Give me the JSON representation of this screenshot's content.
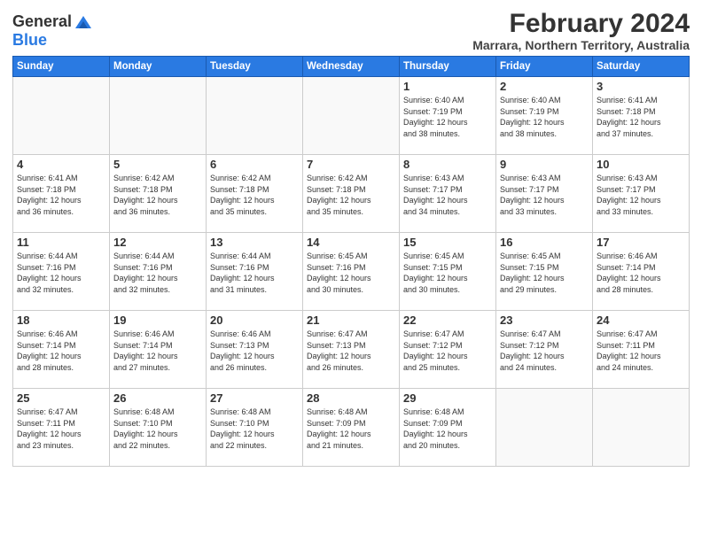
{
  "logo": {
    "general": "General",
    "blue": "Blue"
  },
  "title": "February 2024",
  "subtitle": "Marrara, Northern Territory, Australia",
  "days_of_week": [
    "Sunday",
    "Monday",
    "Tuesday",
    "Wednesday",
    "Thursday",
    "Friday",
    "Saturday"
  ],
  "weeks": [
    [
      {
        "day": "",
        "info": ""
      },
      {
        "day": "",
        "info": ""
      },
      {
        "day": "",
        "info": ""
      },
      {
        "day": "",
        "info": ""
      },
      {
        "day": "1",
        "info": "Sunrise: 6:40 AM\nSunset: 7:19 PM\nDaylight: 12 hours\nand 38 minutes."
      },
      {
        "day": "2",
        "info": "Sunrise: 6:40 AM\nSunset: 7:19 PM\nDaylight: 12 hours\nand 38 minutes."
      },
      {
        "day": "3",
        "info": "Sunrise: 6:41 AM\nSunset: 7:18 PM\nDaylight: 12 hours\nand 37 minutes."
      }
    ],
    [
      {
        "day": "4",
        "info": "Sunrise: 6:41 AM\nSunset: 7:18 PM\nDaylight: 12 hours\nand 36 minutes."
      },
      {
        "day": "5",
        "info": "Sunrise: 6:42 AM\nSunset: 7:18 PM\nDaylight: 12 hours\nand 36 minutes."
      },
      {
        "day": "6",
        "info": "Sunrise: 6:42 AM\nSunset: 7:18 PM\nDaylight: 12 hours\nand 35 minutes."
      },
      {
        "day": "7",
        "info": "Sunrise: 6:42 AM\nSunset: 7:18 PM\nDaylight: 12 hours\nand 35 minutes."
      },
      {
        "day": "8",
        "info": "Sunrise: 6:43 AM\nSunset: 7:17 PM\nDaylight: 12 hours\nand 34 minutes."
      },
      {
        "day": "9",
        "info": "Sunrise: 6:43 AM\nSunset: 7:17 PM\nDaylight: 12 hours\nand 33 minutes."
      },
      {
        "day": "10",
        "info": "Sunrise: 6:43 AM\nSunset: 7:17 PM\nDaylight: 12 hours\nand 33 minutes."
      }
    ],
    [
      {
        "day": "11",
        "info": "Sunrise: 6:44 AM\nSunset: 7:16 PM\nDaylight: 12 hours\nand 32 minutes."
      },
      {
        "day": "12",
        "info": "Sunrise: 6:44 AM\nSunset: 7:16 PM\nDaylight: 12 hours\nand 32 minutes."
      },
      {
        "day": "13",
        "info": "Sunrise: 6:44 AM\nSunset: 7:16 PM\nDaylight: 12 hours\nand 31 minutes."
      },
      {
        "day": "14",
        "info": "Sunrise: 6:45 AM\nSunset: 7:16 PM\nDaylight: 12 hours\nand 30 minutes."
      },
      {
        "day": "15",
        "info": "Sunrise: 6:45 AM\nSunset: 7:15 PM\nDaylight: 12 hours\nand 30 minutes."
      },
      {
        "day": "16",
        "info": "Sunrise: 6:45 AM\nSunset: 7:15 PM\nDaylight: 12 hours\nand 29 minutes."
      },
      {
        "day": "17",
        "info": "Sunrise: 6:46 AM\nSunset: 7:14 PM\nDaylight: 12 hours\nand 28 minutes."
      }
    ],
    [
      {
        "day": "18",
        "info": "Sunrise: 6:46 AM\nSunset: 7:14 PM\nDaylight: 12 hours\nand 28 minutes."
      },
      {
        "day": "19",
        "info": "Sunrise: 6:46 AM\nSunset: 7:14 PM\nDaylight: 12 hours\nand 27 minutes."
      },
      {
        "day": "20",
        "info": "Sunrise: 6:46 AM\nSunset: 7:13 PM\nDaylight: 12 hours\nand 26 minutes."
      },
      {
        "day": "21",
        "info": "Sunrise: 6:47 AM\nSunset: 7:13 PM\nDaylight: 12 hours\nand 26 minutes."
      },
      {
        "day": "22",
        "info": "Sunrise: 6:47 AM\nSunset: 7:12 PM\nDaylight: 12 hours\nand 25 minutes."
      },
      {
        "day": "23",
        "info": "Sunrise: 6:47 AM\nSunset: 7:12 PM\nDaylight: 12 hours\nand 24 minutes."
      },
      {
        "day": "24",
        "info": "Sunrise: 6:47 AM\nSunset: 7:11 PM\nDaylight: 12 hours\nand 24 minutes."
      }
    ],
    [
      {
        "day": "25",
        "info": "Sunrise: 6:47 AM\nSunset: 7:11 PM\nDaylight: 12 hours\nand 23 minutes."
      },
      {
        "day": "26",
        "info": "Sunrise: 6:48 AM\nSunset: 7:10 PM\nDaylight: 12 hours\nand 22 minutes."
      },
      {
        "day": "27",
        "info": "Sunrise: 6:48 AM\nSunset: 7:10 PM\nDaylight: 12 hours\nand 22 minutes."
      },
      {
        "day": "28",
        "info": "Sunrise: 6:48 AM\nSunset: 7:09 PM\nDaylight: 12 hours\nand 21 minutes."
      },
      {
        "day": "29",
        "info": "Sunrise: 6:48 AM\nSunset: 7:09 PM\nDaylight: 12 hours\nand 20 minutes."
      },
      {
        "day": "",
        "info": ""
      },
      {
        "day": "",
        "info": ""
      }
    ]
  ]
}
